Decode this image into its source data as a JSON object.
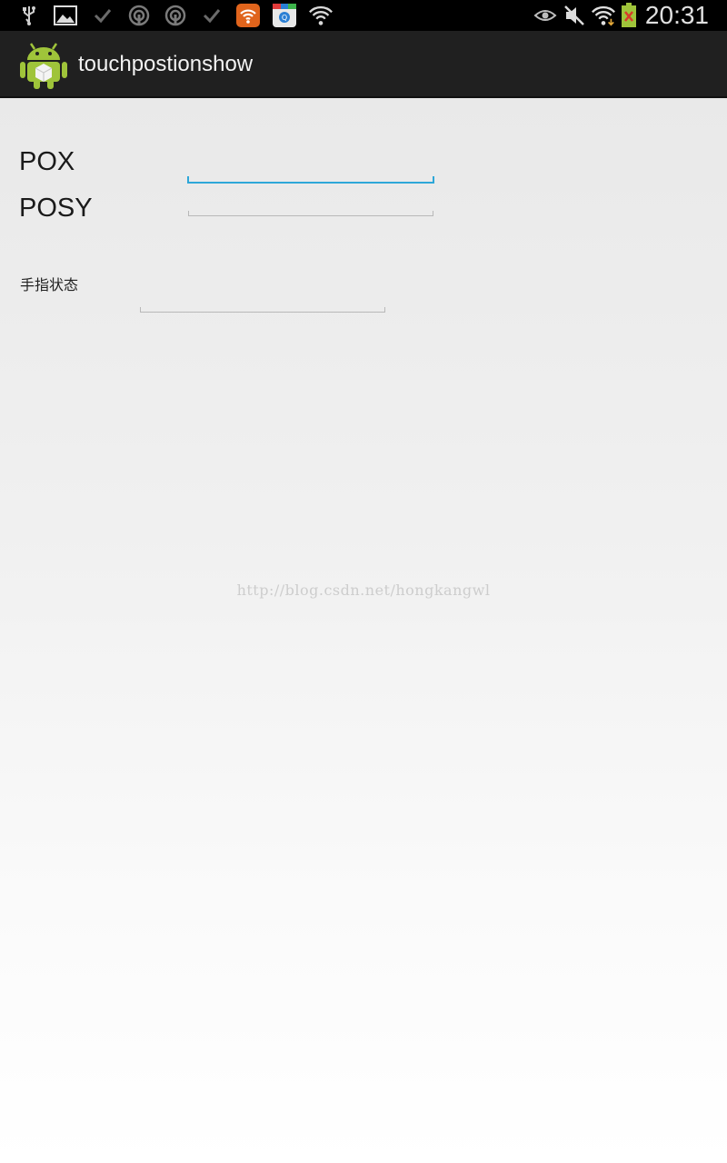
{
  "status_bar": {
    "notification_icons": [
      "usb-icon",
      "image-icon",
      "check-icon",
      "podcast-icon",
      "podcast-icon",
      "check-icon",
      "wifi-hotspot-app-icon",
      "store-app-icon",
      "wifi-question-icon"
    ],
    "system_icons": [
      "eye-icon",
      "mute-icon",
      "wifi-icon",
      "battery-icon"
    ],
    "time": "20:31"
  },
  "action_bar": {
    "app_icon": "android-icon",
    "title": "touchpostionshow"
  },
  "form": {
    "pox_label": "POX",
    "pox_value": "",
    "posy_label": "POSY",
    "posy_value": "",
    "finger_state_label": "手指状态",
    "finger_state_value": ""
  },
  "watermark": "http://blog.csdn.net/hongkangwl",
  "colors": {
    "focus_accent": "#2ea7d8",
    "actionbar_bg": "#202020",
    "android_green": "#9fc43a"
  }
}
